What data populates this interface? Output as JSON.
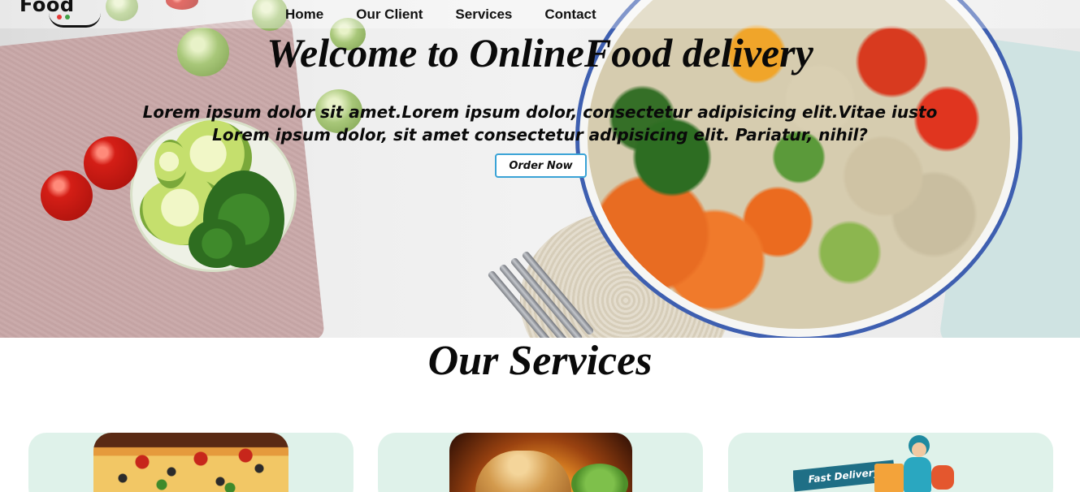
{
  "header": {
    "logo": {
      "text": "Food",
      "accent": "#111111",
      "dot_colors": [
        "#e53935",
        "#43a047"
      ]
    },
    "nav": [
      {
        "label": "Home"
      },
      {
        "label": "Our Client"
      },
      {
        "label": "Services"
      },
      {
        "label": "Contact"
      }
    ]
  },
  "hero": {
    "title": "Welcome to OnlineFood delivery",
    "description_line1": "Lorem ipsum dolor sit amet.Lorem ipsum dolor, consectetur adipisicing elit.Vitae iusto",
    "description_line2": "Lorem ipsum dolor, sit amet consectetur adipisicing elit. Pariatur, nihil?",
    "cta_label": "Order Now",
    "cta_border_color": "#3aa3d6",
    "background_image": "salad-bowl-photo"
  },
  "services": {
    "title": "Our Services",
    "card_color": "#dff2ea",
    "cards": [
      {
        "image": "pizza-photo"
      },
      {
        "image": "burger-photo"
      },
      {
        "image": "fast-delivery-illustration",
        "ribbon_text": "Fast Delivery"
      }
    ]
  }
}
